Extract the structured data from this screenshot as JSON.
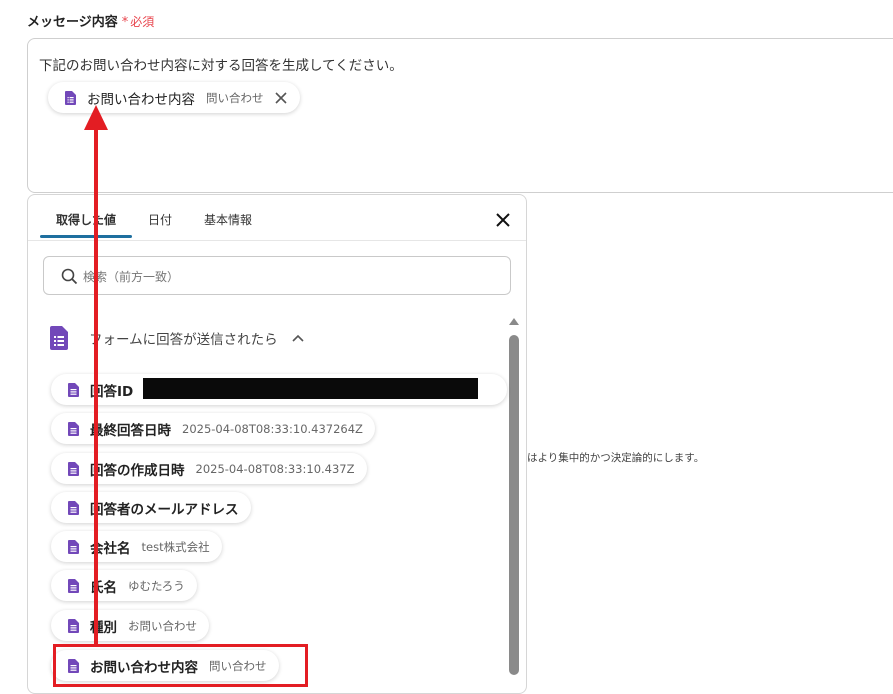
{
  "field": {
    "label": "メッセージ内容",
    "required_star": "*",
    "required_text": "必須"
  },
  "message": {
    "text": "下記のお問い合わせ内容に対する回答を生成してください。",
    "chip": {
      "label": "お問い合わせ内容",
      "value": "問い合わせ",
      "close_icon": "close-icon"
    }
  },
  "panel": {
    "tabs": [
      {
        "label": "取得した値",
        "active": true
      },
      {
        "label": "日付",
        "active": false
      },
      {
        "label": "基本情報",
        "active": false
      }
    ],
    "search_placeholder": "検索（前方一致）",
    "group": {
      "title": "フォームに回答が送信されたら",
      "icon": "google-forms-icon",
      "expanded": true
    },
    "items": [
      {
        "label": "回答ID",
        "value": ""
      },
      {
        "label": "最終回答日時",
        "value": "2025-04-08T08:33:10.437264Z"
      },
      {
        "label": "回答の作成日時",
        "value": "2025-04-08T08:33:10.437Z"
      },
      {
        "label": "回答者のメールアドレス",
        "value": ""
      },
      {
        "label": "会社名",
        "value": "test株式会社"
      },
      {
        "label": "氏名",
        "value": "ゆむたろう"
      },
      {
        "label": "種別",
        "value": "お問い合わせ"
      },
      {
        "label": "お問い合わせ内容",
        "value": "問い合わせ"
      }
    ]
  },
  "background_text": "はより集中的かつ決定論的にします。",
  "colors": {
    "accent": "#1e6f9f",
    "required": "#e8454d",
    "doc_icon": "#7248b9",
    "annotation_red": "#e31d23"
  }
}
